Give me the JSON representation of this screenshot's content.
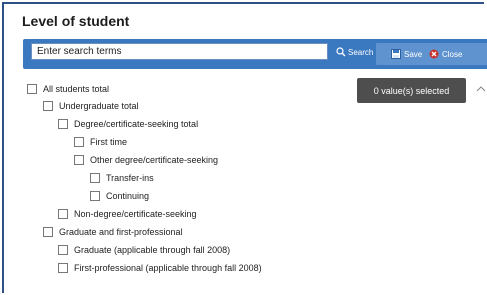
{
  "panel": {
    "title": "Level of student"
  },
  "toolbar": {
    "search_placeholder": "Enter search terms",
    "search_label": "Search",
    "save_label": "Save",
    "close_label": "Close"
  },
  "tooltip": {
    "text": "0 value(s) selected"
  },
  "tree": {
    "items": [
      {
        "label": "All students total",
        "level": 0,
        "checked": false
      },
      {
        "label": "Undergraduate total",
        "level": 1,
        "checked": false
      },
      {
        "label": "Degree/certificate-seeking total",
        "level": 2,
        "checked": false
      },
      {
        "label": "First time",
        "level": 3,
        "checked": false
      },
      {
        "label": "Other degree/certificate-seeking",
        "level": 3,
        "checked": false
      },
      {
        "label": "Transfer-ins",
        "level": 4,
        "checked": false
      },
      {
        "label": "Continuing",
        "level": 4,
        "checked": false
      },
      {
        "label": "Non-degree/certificate-seeking",
        "level": 2,
        "checked": false
      },
      {
        "label": "Graduate and first-professional",
        "level": 1,
        "checked": false
      },
      {
        "label": "Graduate (applicable through fall 2008)",
        "level": 2,
        "checked": false
      },
      {
        "label": "First-professional (applicable through fall 2008)",
        "level": 2,
        "checked": false
      }
    ]
  },
  "colors": {
    "toolbar": "#3a78c0",
    "button_group": "#5f93cf",
    "frame": "#2f4f87",
    "tooltip": "#4e4e4e"
  }
}
